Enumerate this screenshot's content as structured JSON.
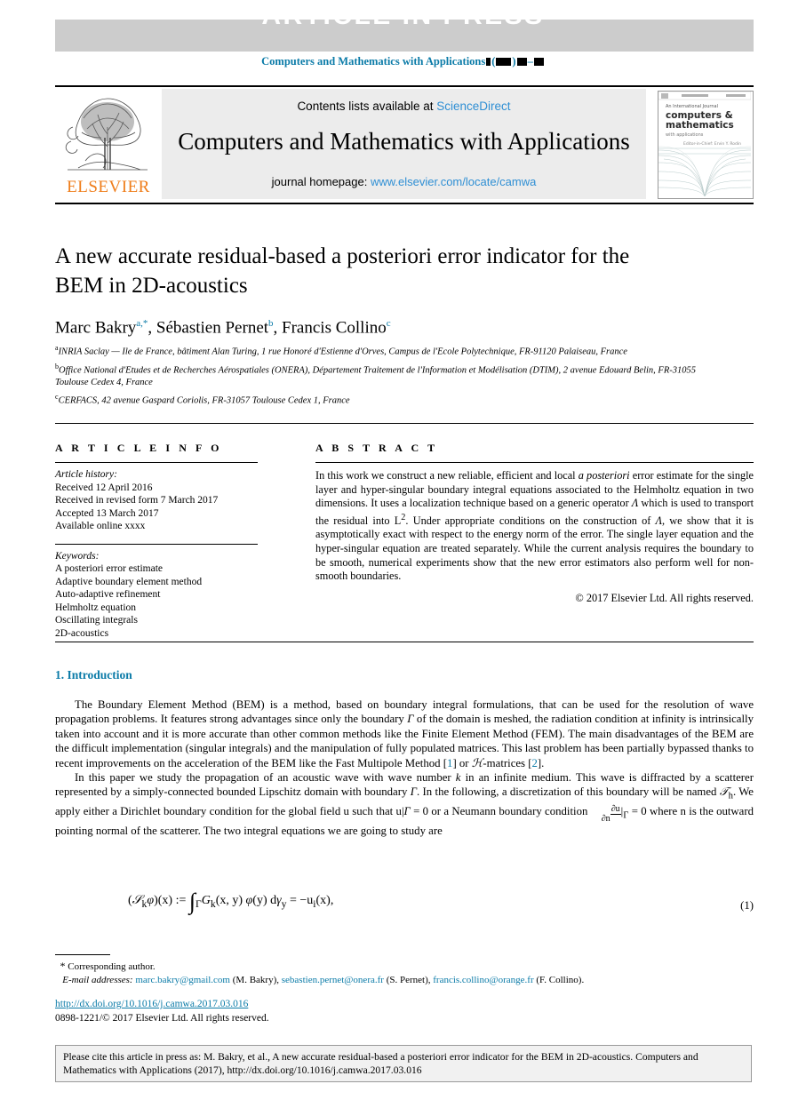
{
  "banner": {
    "article_in_press": "ARTICLE  IN  PRESS",
    "journal_ref_prefix": "Computers and Mathematics with Applications"
  },
  "masthead": {
    "contents_prefix": "Contents lists available at ",
    "sciencedirect": "ScienceDirect",
    "journal_title": "Computers and Mathematics with Applications",
    "homepage_prefix": "journal homepage: ",
    "homepage_url": "www.elsevier.com/locate/camwa",
    "publisher": "ELSEVIER",
    "cover": {
      "line1": "An International Journal",
      "line2": "computers &",
      "line3": "mathematics",
      "line4": "with applications",
      "line5": "Editor-in-Chief: Ervin Y. Rodin"
    }
  },
  "article": {
    "title": "A new accurate residual-based a posteriori error indicator for the BEM in 2D-acoustics",
    "authors": [
      {
        "name": "Marc Bakry",
        "sup": "a,",
        "star": "*"
      },
      {
        "name": "Sébastien Pernet",
        "sup": "b"
      },
      {
        "name": "Francis Collino",
        "sup": "c"
      }
    ],
    "affiliations": [
      {
        "marker": "a",
        "text": "INRIA Saclay — Ile de France, bâtiment Alan Turing, 1 rue Honoré d'Estienne d'Orves, Campus de l'Ecole Polytechnique, FR-91120 Palaiseau, France"
      },
      {
        "marker": "b",
        "text": "Office National d'Etudes et de Recherches Aérospatiales (ONERA), Département Traitement de l'Information et Modélisation (DTIM), 2 avenue Edouard Belin, FR-31055 Toulouse Cedex 4, France"
      },
      {
        "marker": "c",
        "text": "CERFACS, 42 avenue Gaspard Coriolis, FR-31057 Toulouse Cedex 1, France"
      }
    ]
  },
  "article_info": {
    "heading": "A R T I C L E    I N F O",
    "history_label": "Article history:",
    "history": [
      "Received 12 April 2016",
      "Received in revised form 7 March 2017",
      "Accepted 13 March 2017",
      "Available online xxxx"
    ],
    "keywords_label": "Keywords:",
    "keywords": [
      "A posteriori error estimate",
      "Adaptive boundary element method",
      "Auto-adaptive refinement",
      "Helmholtz equation",
      "Oscillating integrals",
      "2D-acoustics"
    ]
  },
  "abstract": {
    "heading": "A B S T R A C T",
    "part1": "In this work we construct a new reliable, efficient and local ",
    "italic1": "a posteriori",
    "part2": " error estimate for the single layer and hyper-singular boundary integral equations associated to the Helmholtz equation in two dimensions. It uses a localization technique based on a generic operator ",
    "opA": "Λ",
    "part3": " which is used to transport the residual into L",
    "sup2": "2",
    "part4": ". Under appropriate conditions on the construction of ",
    "opA2": "Λ",
    "part5": ", we show that it is asymptotically exact with respect to the energy norm of the error. The single layer equation and the hyper-singular equation are treated separately. While the current analysis requires the boundary to be smooth, numerical experiments show that the new error estimators also perform well for non-smooth boundaries.",
    "copyright": "© 2017 Elsevier Ltd. All rights reserved."
  },
  "section": {
    "number_title": "1. Introduction",
    "para1_a": "The Boundary Element Method (BEM) is a method, based on boundary integral formulations, that can be used for the resolution of wave propagation problems. It features strong advantages since only the boundary ",
    "gamma": "Γ",
    "para1_b": " of the domain is meshed, the radiation condition at infinity is intrinsically taken into account and it is more accurate than other common methods like the Finite Element Method (FEM). The main disadvantages of the BEM are the difficult implementation (singular integrals) and the manipulation of fully populated matrices. This last problem has been partially bypassed thanks to recent improvements on the acceleration of the BEM like the Fast Multipole Method [",
    "ref1": "1",
    "para1_c": "] or ",
    "hcal": "ℋ",
    "para1_d": "-matrices [",
    "ref2": "2",
    "para1_e": "].",
    "para2_a": "In this paper we study the propagation of an acoustic wave with wave number ",
    "k": "k",
    "para2_b": " in an infinite medium. This wave is diffracted by a scatterer represented by a simply-connected bounded Lipschitz domain with boundary ",
    "gamma2": "Γ",
    "para2_c": ". In the following, a discretization of this boundary will be named ",
    "th": "𝒯",
    "th_sub": "h",
    "para2_d": ". We apply either a Dirichlet boundary condition for the global field u such that u|",
    "gamma3": "Γ",
    "para2_e": " = 0 or a Neumann boundary condition ",
    "neumann_num": "∂u",
    "neumann_den": "∂n",
    "neumann_bar": "|",
    "gamma4": "Γ",
    "para2_f": " = 0 where n is the outward pointing normal of the scatterer. The two integral equations we are going to study are"
  },
  "equation": {
    "lhs_open": "(",
    "script_s": "𝒮",
    "sub_k": "k",
    "phi": "φ",
    "lhs_close": ")(x) := ",
    "integral": "∫",
    "int_sub": "Γ",
    "kernel": "G",
    "kernel_sub": "k",
    "kernel_args": "(x, y) ",
    "phi2": "φ",
    "phi_args": "(y) d",
    "gamma_meas": "γ",
    "gamma_meas_sub": "y",
    "equals": " = −u",
    "ui_sub": "i",
    "ui_args": "(x),",
    "number": "(1)"
  },
  "footnote": {
    "star": "*",
    "corresponding": "Corresponding author.",
    "email_label": "E-mail addresses:",
    "emails": [
      {
        "addr": "marc.bakry@gmail.com",
        "owner": "(M. Bakry),"
      },
      {
        "addr": "sebastien.pernet@onera.fr",
        "owner": "(S. Pernet),"
      },
      {
        "addr": "francis.collino@orange.fr",
        "owner": "(F. Collino)."
      }
    ],
    "doi": "http://dx.doi.org/10.1016/j.camwa.2017.03.016",
    "issn": "0898-1221/© 2017 Elsevier Ltd. All rights reserved."
  },
  "cite_box": {
    "text": "Please cite this article in press as: M. Bakry, et al., A new accurate residual-based a posteriori error indicator for the BEM in 2D-acoustics. Computers and Mathematics with Applications (2017), http://dx.doi.org/10.1016/j.camwa.2017.03.016"
  },
  "colors": {
    "link_blue": "#0b7ba8",
    "sd_blue": "#2f8fd4",
    "elsevier_orange": "#ef7d1a",
    "banner_grey": "#cccccc",
    "masthead_grey": "#ececec"
  }
}
